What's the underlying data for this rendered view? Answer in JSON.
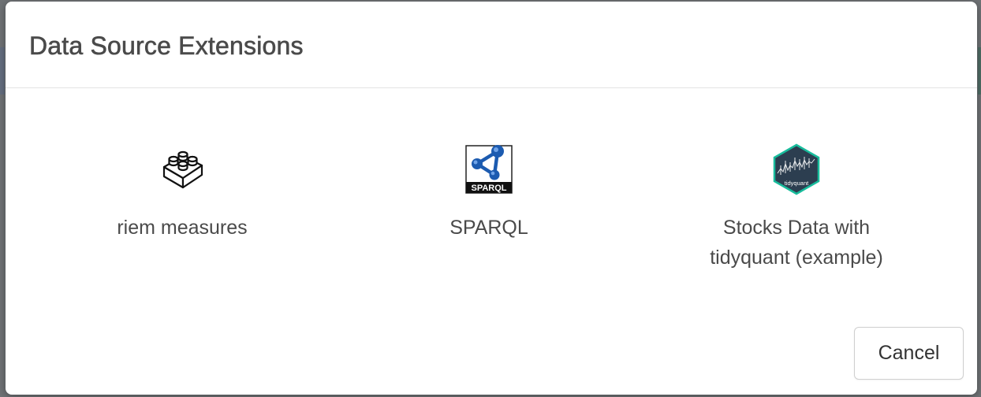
{
  "dialog": {
    "title": "Data Source Extensions"
  },
  "extensions": [
    {
      "label": "riem measures",
      "icon": "lego-brick-icon"
    },
    {
      "label": "SPARQL",
      "icon": "sparql-logo-icon"
    },
    {
      "label": "Stocks Data with tidyquant (example)",
      "icon": "tidyquant-hex-icon",
      "icon_caption": "tidyquant"
    }
  ],
  "footer": {
    "cancel_label": "Cancel"
  },
  "colors": {
    "sparql_blue": "#1c5bb0",
    "tidyquant_bg": "#2c3e50",
    "tidyquant_border": "#18bc9c"
  }
}
